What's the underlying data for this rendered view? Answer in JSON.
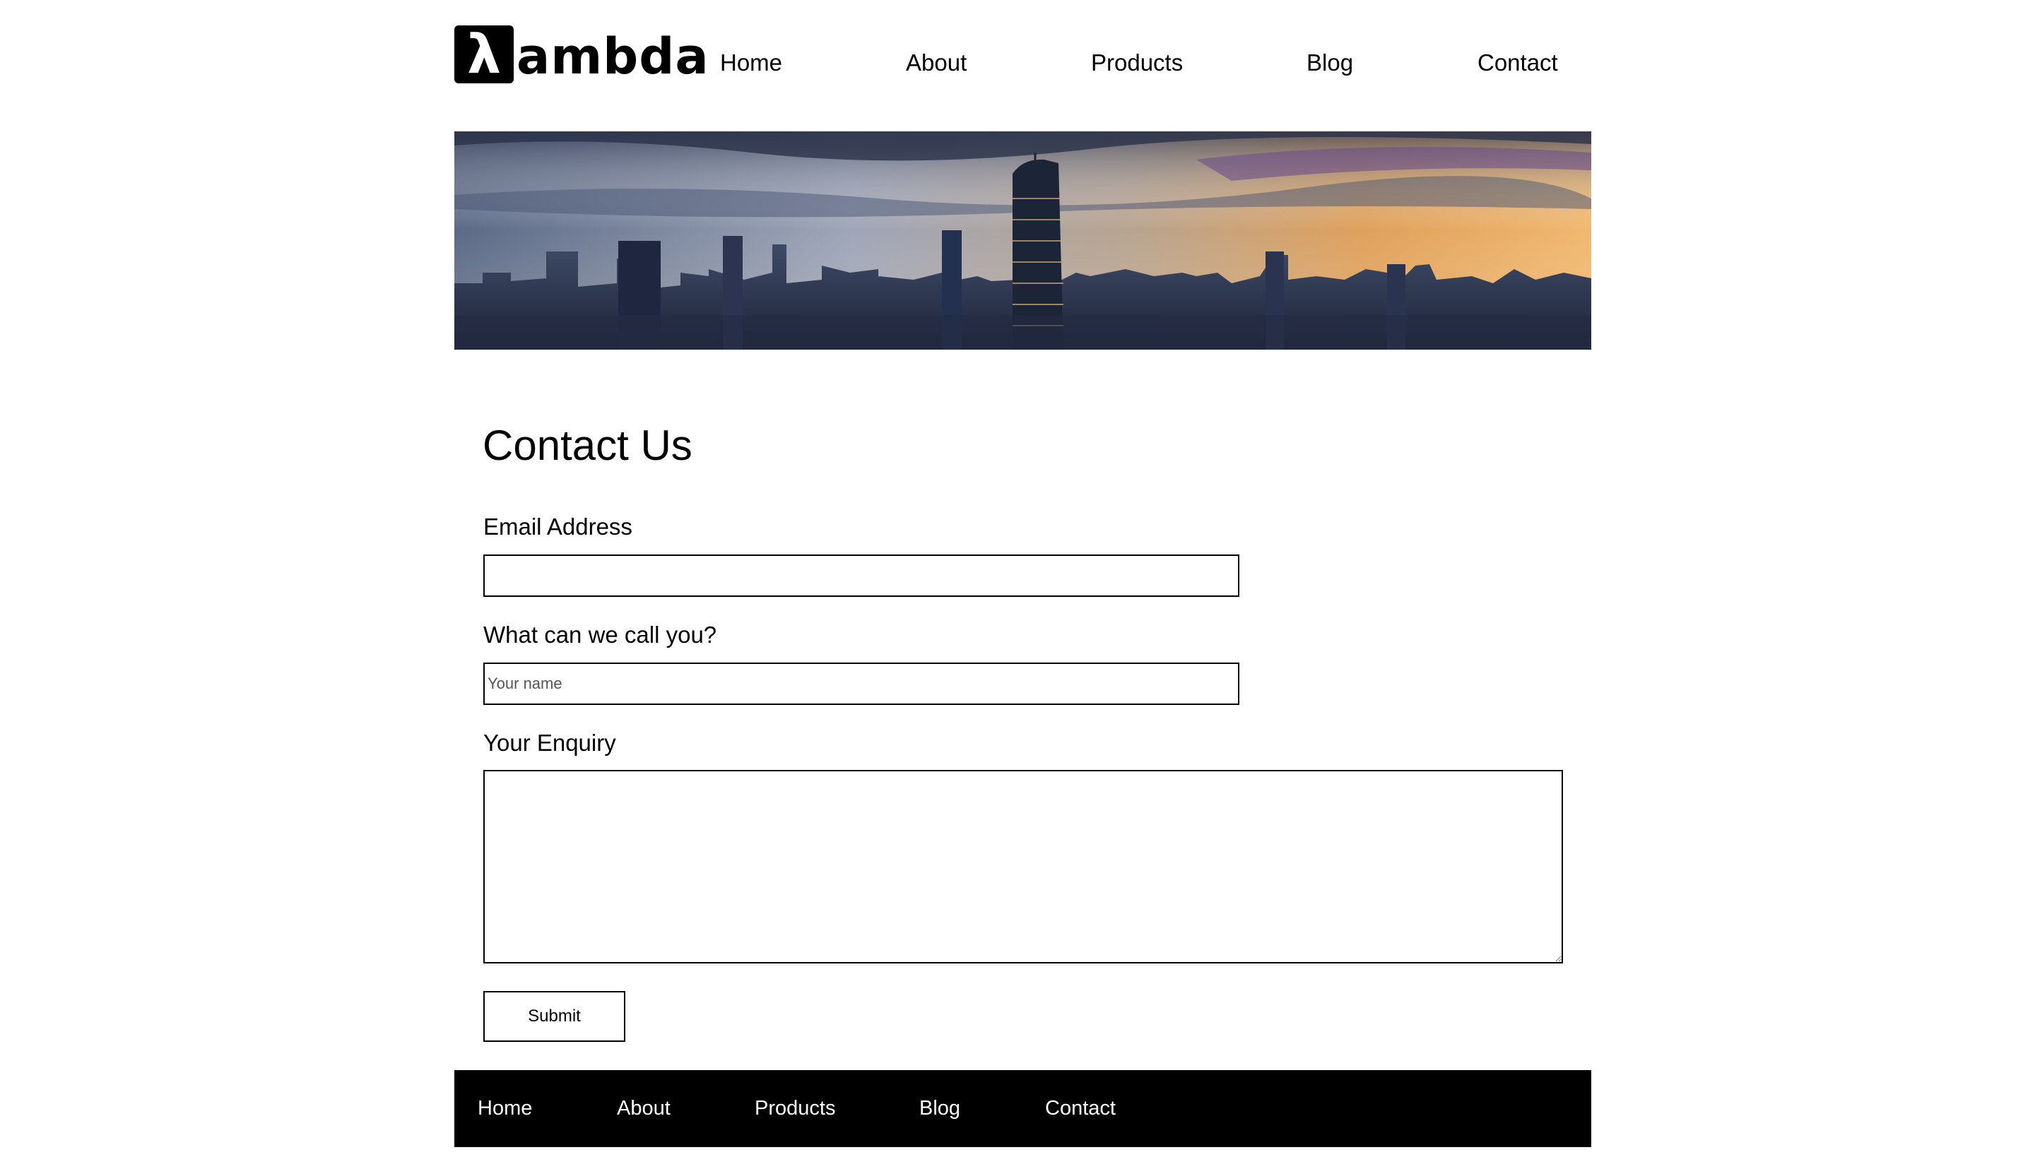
{
  "brand": {
    "mark": "λ",
    "name": "ambda"
  },
  "nav": [
    "Home",
    "About",
    "Products",
    "Blog",
    "Contact"
  ],
  "form": {
    "title": "Contact Us",
    "email_label": "Email Address",
    "email_value": "",
    "name_label": "What can we call you?",
    "name_placeholder": "Your name",
    "enquiry_label": "Your Enquiry",
    "enquiry_value": "",
    "submit_label": "Submit"
  },
  "footer_nav": [
    "Home",
    "About",
    "Products",
    "Blog",
    "Contact"
  ],
  "colors": {
    "footer_bg": "#000000",
    "text": "#000000",
    "background": "#ffffff"
  }
}
